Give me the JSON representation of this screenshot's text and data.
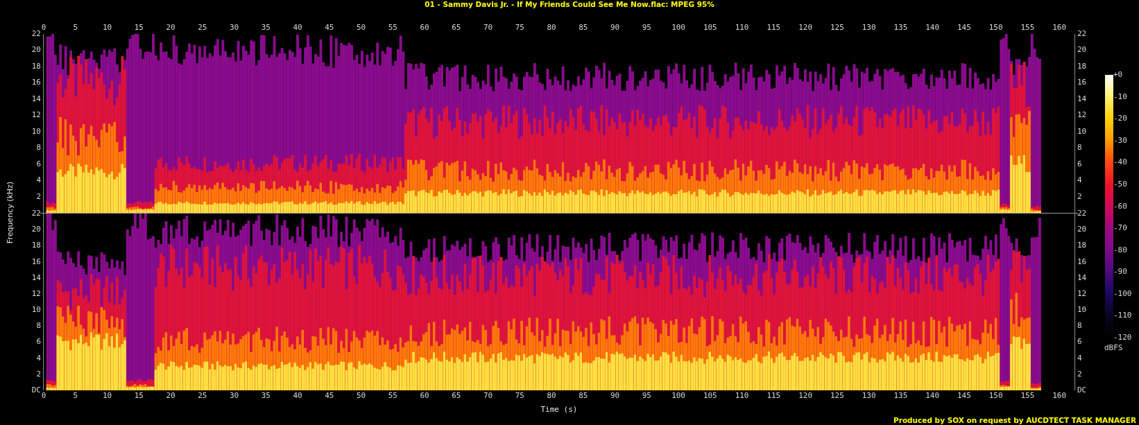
{
  "title": "01 - Sammy Davis Jr. - If My Friends Could See Me Now.flac: MPEG 95%",
  "time_axis": {
    "top_ticks": [
      "0",
      "5",
      "10",
      "15",
      "20",
      "25",
      "30",
      "35",
      "40",
      "45",
      "50",
      "55",
      "60",
      "65",
      "70",
      "75",
      "80",
      "85",
      "90",
      "95",
      "100",
      "105",
      "110",
      "115",
      "120",
      "125",
      "130",
      "135",
      "140",
      "145",
      "150",
      "155",
      "160"
    ],
    "bottom_ticks": [
      "0",
      "5",
      "10",
      "15",
      "20",
      "25",
      "30",
      "35",
      "40",
      "45",
      "50",
      "55",
      "60",
      "65",
      "70",
      "75",
      "80",
      "85",
      "90",
      "95",
      "100",
      "105",
      "110",
      "115",
      "120",
      "125",
      "130",
      "135",
      "140",
      "145",
      "150",
      "155",
      "160"
    ],
    "label": "Time (s)"
  },
  "frequency_axis": {
    "label": "Frequency (kHz)"
  },
  "channels": [
    {
      "left_ticks": [
        "22",
        "20",
        "18",
        "16",
        "14",
        "12",
        "10",
        "8",
        "6",
        "4",
        "2"
      ],
      "right_ticks": [
        "22",
        "20",
        "18",
        "16",
        "14",
        "12",
        "10",
        "8",
        "6",
        "4",
        "2"
      ]
    },
    {
      "left_ticks": [
        "22",
        "20",
        "18",
        "16",
        "14",
        "12",
        "10",
        "8",
        "6",
        "4",
        "2",
        "DC"
      ],
      "right_ticks": [
        "22",
        "20",
        "18",
        "16",
        "14",
        "12",
        "10",
        "8",
        "6",
        "4",
        "2",
        "DC"
      ]
    }
  ],
  "color_scale": {
    "ticks": [
      "+0",
      "-10",
      "-20",
      "-30",
      "-40",
      "-50",
      "-60",
      "-70",
      "-80",
      "-90",
      "-100",
      "-110",
      "-120"
    ],
    "unit": "dBFS"
  },
  "footer": "Produced by SOX on request by AUCDTECT TASK MANAGER"
}
